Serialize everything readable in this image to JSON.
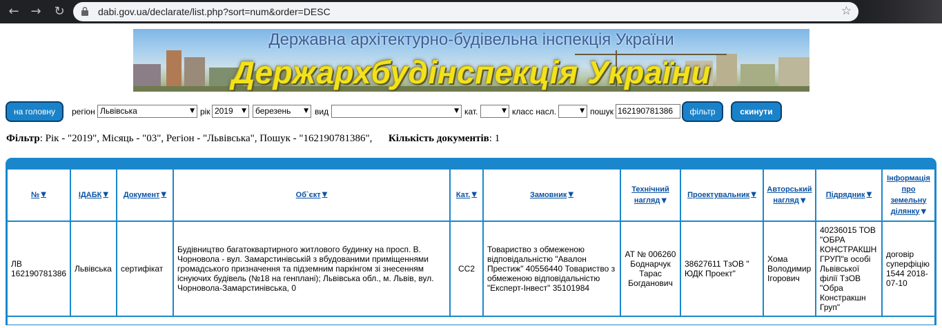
{
  "browser": {
    "url": "dabi.gov.ua/declarate/list.php?sort=num&order=DESC"
  },
  "banner": {
    "top_text": "Державна архітектурно-будівельна інспекція України",
    "main_text": "Держархбудінспекція України"
  },
  "filters": {
    "home_button": "на головну",
    "region_label": "регіон",
    "region_value": "Львівська",
    "year_label": "рік",
    "year_value": "2019",
    "month_value": "березень",
    "type_label": "вид",
    "type_value": "",
    "cat_label": "кат.",
    "cat_value": "",
    "class_label": "класс насл.",
    "class_value": "",
    "search_label": "пошук",
    "search_value": "162190781386",
    "filter_button": "фільтр",
    "reset_button": "скинути"
  },
  "summary": {
    "filter_label": "Фільтр",
    "filter_text": ": Рік - \"2019\", Місяць - \"03\", Регіон - \"Львівська\", Пошук - \"162190781386\",",
    "count_label": "Кількість документів",
    "count_value": ": 1"
  },
  "table": {
    "headers": [
      "№",
      "ІДАБК",
      "Документ",
      "Об`єкт",
      "Кат.",
      "Замовник",
      "Технічний нагляд",
      "Проектувальник",
      "Авторський нагляд",
      "Підрядник",
      "Інформація про земельну ділянку"
    ],
    "rows": [
      [
        "ЛВ 162190781386",
        "Львівська",
        "сертифікат",
        "Будівництво багатоквартирного житлового будинку на просп. В. Чорновола - вул. Замарстинівській з вбудованими приміщеннями громадського призначення та підземним паркінгом зі знесенням існуючих будівель (№18 на генплані); Львівська обл., м. Львів, вул. Чорновола-Замарстинівська, 0",
        "СС2",
        "Товариство з обмеженою відповідальністю \"Авалон Престиж\" 40556440 Товариство з обмеженою відповідальністю \"Експерт-Інвест\" 35101984",
        "АТ № 006260 Боднарчук Тарас Богданович",
        "38627611 ТзОВ \" ЮДК Проект\"",
        "Хома Володимир Ігорович",
        "40236015 ТОВ \"ОБРА КОНСТРАКШН ГРУП\"в особі Львівської філії ТзОВ \"Обра Констракшн Груп\"",
        "договір суперфіцію 1544 2018-07-10"
      ]
    ]
  }
}
